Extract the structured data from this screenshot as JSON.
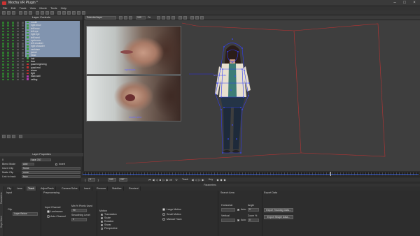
{
  "window": {
    "title": "Mocha VR Plugin *"
  },
  "menu": [
    "File",
    "Edit",
    "Track",
    "View",
    "Movie",
    "Tools",
    "Help"
  ],
  "viewbar": {
    "selected_layer_label": "Selected layer",
    "zoom_value": "100",
    "zoom_mode": "Fit"
  },
  "layer_controls": {
    "title": "Layer Controls"
  },
  "layers": [
    {
      "name": "mouth",
      "color": "#3c9e3c",
      "selected": true
    },
    {
      "name": "right brow",
      "color": "#3c9e3c",
      "selected": true
    },
    {
      "name": "left brow",
      "color": "#3c9e3c",
      "selected": true
    },
    {
      "name": "left eye",
      "color": "#3c9e3c",
      "selected": true
    },
    {
      "name": "right eye",
      "color": "#3c9e3c",
      "selected": true
    },
    {
      "name": "left hand",
      "color": "#3c9e3c",
      "selected": true
    },
    {
      "name": "eyebrows",
      "color": "#3c9e3c",
      "selected": true
    },
    {
      "name": "left shoulder",
      "color": "#3c9e3c",
      "selected": true
    },
    {
      "name": "right shoulder",
      "color": "#3c9e3c",
      "selected": true
    },
    {
      "name": "necklace",
      "color": "#3c9e3c",
      "selected": true
    },
    {
      "name": "jacket",
      "color": "#3c9e3c",
      "selected": true
    },
    {
      "name": "head",
      "color": "#3c9e3c",
      "selected": true
    },
    {
      "name": "hair",
      "color": "#3c9e3c",
      "selected": true
    },
    {
      "name": "face",
      "color": "#3c9e3c",
      "selected": true
    },
    {
      "name": "quad beginning",
      "color": "#c23030",
      "selected": false
    },
    {
      "name": "quad end",
      "color": "#c23030",
      "selected": false
    },
    {
      "name": "shoes",
      "color": "#c23030",
      "selected": false
    },
    {
      "name": "light",
      "color": "#c23030",
      "selected": false
    },
    {
      "name": "back wall",
      "color": "#b03ab0",
      "selected": false
    },
    {
      "name": "ceiling",
      "color": "#b03ab0",
      "selected": false
    }
  ],
  "layer_properties": {
    "title": "Layer Properties",
    "layer_number": "0",
    "layer_name": "face 787",
    "blend_mode_label": "Blend Mode",
    "blend_mode_value": "Add",
    "invert_label": "Invert",
    "insert_clip_label": "Insert Clip",
    "insert_clip_value": "None",
    "matte_clip_label": "Matte Clip",
    "matte_clip_value": "none",
    "link_to_track_label": "Link to track",
    "link_to_track_value": "face"
  },
  "viewer": {
    "clip_top_label": "eyebrows",
    "clip_bottom_label": "mouth area",
    "guide_label": "left shoulder"
  },
  "timeline": {
    "in_frame": "0",
    "current_frame": "100",
    "out_frame": "287",
    "track_label": "Track",
    "key_label": "Key"
  },
  "parameters": {
    "title": "Parameters"
  },
  "tabs": [
    "Clip",
    "Lens",
    "Track",
    "AdjustTrack",
    "Camera Solve",
    "Insert",
    "Remove",
    "Stabilize",
    "Reorient"
  ],
  "active_tab": "Track",
  "vertical_tabs": [
    "Parameters",
    "Dope Sheet"
  ],
  "track_params": {
    "input_title": "Input",
    "preprocessing_title": "Preprocessing",
    "clip_label": "Clip",
    "clip_value": "Layer Below",
    "input_channel_label": "Input Channel",
    "luminance_label": "Luminance",
    "auto_channel_label": "Auto Channel",
    "min_pixels_label": "Min % Pixels Used",
    "min_pixels_value": "90",
    "smoothing_label": "Smoothing Level",
    "smoothing_value": "0",
    "motion_title": "Motion",
    "motion_options": [
      {
        "label": "Translation",
        "checked": true
      },
      {
        "label": "Scale",
        "checked": true
      },
      {
        "label": "Rotation",
        "checked": true
      },
      {
        "label": "Shear",
        "checked": true
      },
      {
        "label": "Perspective",
        "checked": false
      }
    ],
    "motion_type_options": [
      {
        "label": "Large Motion",
        "checked": true
      },
      {
        "label": "Small Motion",
        "checked": false
      },
      {
        "label": "Manual Track",
        "checked": false
      }
    ],
    "search_area_title": "Search Area",
    "horizontal_label": "Horizontal",
    "vertical_label": "Vertical",
    "auto_label": "Auto",
    "angle_label": "Angle",
    "angle_value": "0",
    "zoom_label": "Zoom %",
    "zoom_value": "0",
    "export_title": "Export Data",
    "export_tracking_btn": "Export Tracking Data...",
    "export_shape_btn": "Export Shape Data..."
  }
}
